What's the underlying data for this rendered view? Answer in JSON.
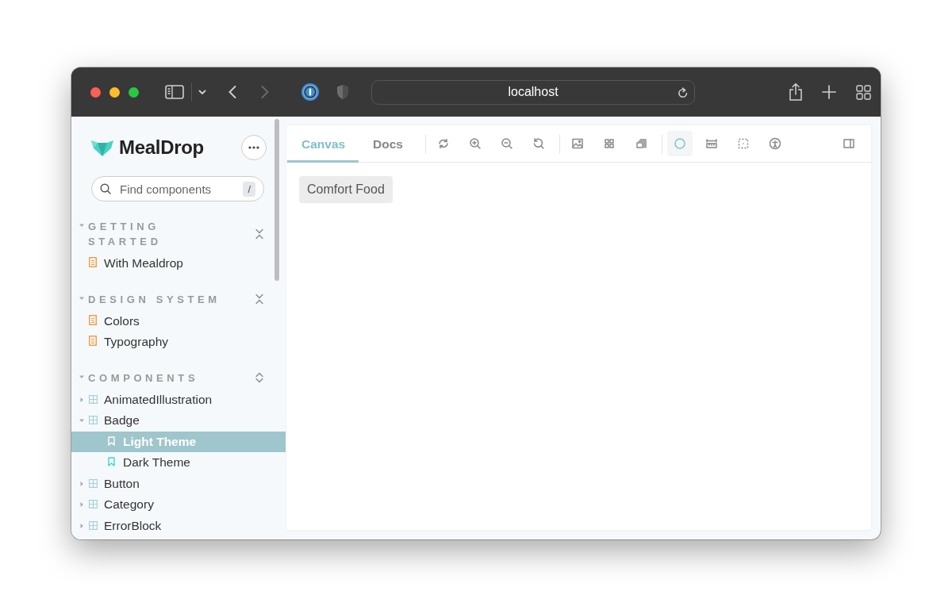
{
  "browser": {
    "url": "localhost"
  },
  "sidebar": {
    "brand": "MealDrop",
    "search": {
      "placeholder": "Find components",
      "shortcut": "/"
    },
    "sections": [
      {
        "title": "GETTING STARTED",
        "expanded": true,
        "all_expanded": true,
        "items": [
          {
            "label": "With Mealdrop",
            "kind": "doc",
            "selected": false
          }
        ]
      },
      {
        "title": "DESIGN SYSTEM",
        "expanded": true,
        "all_expanded": true,
        "items": [
          {
            "label": "Colors",
            "kind": "doc",
            "selected": false
          },
          {
            "label": "Typography",
            "kind": "doc",
            "selected": false
          }
        ]
      },
      {
        "title": "COMPONENTS",
        "expanded": true,
        "all_expanded": false,
        "items": [
          {
            "label": "AnimatedIllustration",
            "kind": "component",
            "expanded": false,
            "selected": false
          },
          {
            "label": "Badge",
            "kind": "component",
            "expanded": true,
            "selected": false,
            "children": [
              {
                "label": "Light Theme",
                "kind": "story",
                "selected": true
              },
              {
                "label": "Dark Theme",
                "kind": "story",
                "selected": false
              }
            ]
          },
          {
            "label": "Button",
            "kind": "component",
            "expanded": false,
            "selected": false
          },
          {
            "label": "Category",
            "kind": "component",
            "expanded": false,
            "selected": false
          },
          {
            "label": "ErrorBlock",
            "kind": "component",
            "expanded": false,
            "selected": false
          }
        ]
      }
    ]
  },
  "canvas": {
    "tabs": [
      {
        "label": "Canvas",
        "selected": true
      },
      {
        "label": "Docs",
        "selected": false
      }
    ],
    "toolbar": {
      "groups": [
        [
          {
            "kind": "sync",
            "selected": false
          },
          {
            "kind": "zoom-in",
            "selected": false
          },
          {
            "kind": "zoom-out",
            "selected": false
          },
          {
            "kind": "zoom-reset",
            "selected": false
          }
        ],
        [
          {
            "kind": "image",
            "selected": false
          },
          {
            "kind": "grid",
            "selected": false
          },
          {
            "kind": "frames",
            "selected": false
          }
        ],
        [
          {
            "kind": "circle",
            "selected": true
          },
          {
            "kind": "ruler",
            "selected": false
          },
          {
            "kind": "dashed-square",
            "selected": false
          },
          {
            "kind": "accessibility",
            "selected": false
          }
        ]
      ],
      "end_tools": [
        {
          "kind": "panel",
          "selected": false
        }
      ]
    },
    "badge": "Comfort Food"
  }
}
